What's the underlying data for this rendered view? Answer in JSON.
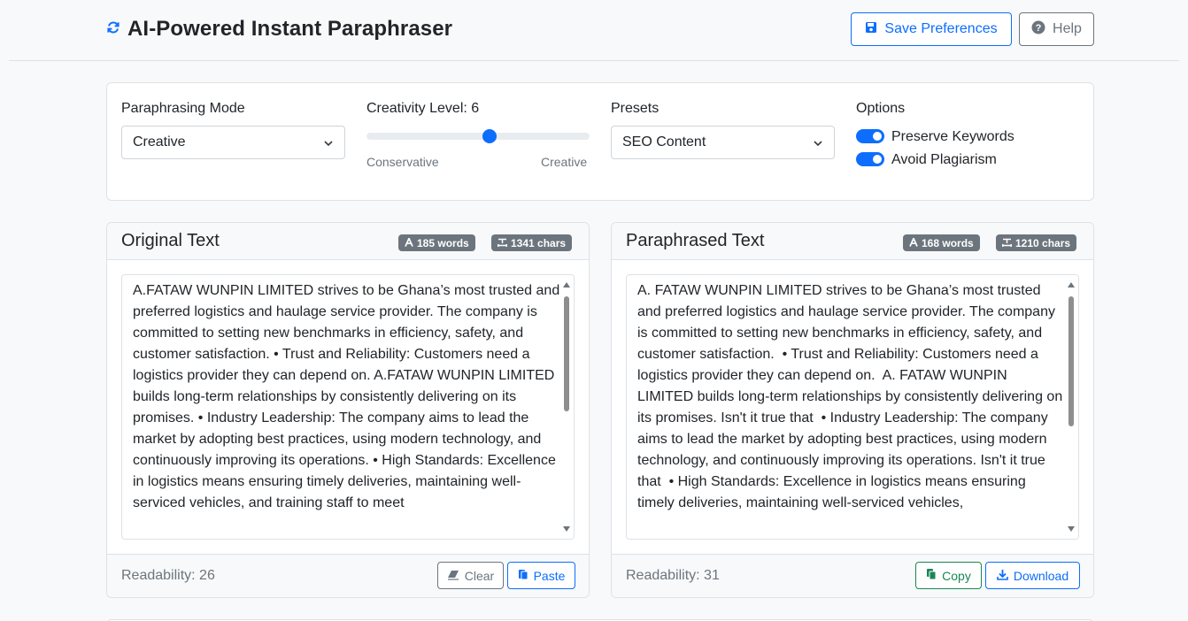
{
  "app": {
    "title": "AI-Powered Instant Paraphraser",
    "save_label": "Save Preferences",
    "help_label": "Help"
  },
  "settings": {
    "mode_label": "Paraphrasing Mode",
    "mode_value": "Creative",
    "creativity_label": "Creativity Level: 6",
    "creativity_value": 6,
    "creativity_min_label": "Conservative",
    "creativity_max_label": "Creative",
    "presets_label": "Presets",
    "presets_value": "SEO Content",
    "options_label": "Options",
    "option_1": "Preserve Keywords",
    "option_1_checked": true,
    "option_2": "Avoid Plagiarism",
    "option_2_checked": true
  },
  "original": {
    "title": "Original Text",
    "words": "185 words",
    "chars": "1341 chars",
    "text": "A.FATAW WUNPIN LIMITED strives to be Ghana’s most trusted and preferred logistics and haulage service provider. The company is committed to setting new benchmarks in efficiency, safety, and customer satisfaction. • Trust and Reliability: Customers need a logistics provider they can depend on. A.FATAW WUNPIN LIMITED builds long-term relationships by consistently delivering on its promises. • Industry Leadership: The company aims to lead the market by adopting best practices, using modern technology, and continuously improving its operations. • High Standards: Excellence in logistics means ensuring timely deliveries, maintaining well-serviced vehicles, and training staff to meet",
    "readability": "Readability: 26",
    "clear_label": "Clear",
    "paste_label": "Paste"
  },
  "paraphrased": {
    "title": "Paraphrased Text",
    "words": "168 words",
    "chars": "1210 chars",
    "text": "A. FATAW WUNPIN LIMITED strives to be Ghana’s most trusted and preferred logistics and haulage service provider. The company is committed to setting new benchmarks in efficiency, safety, and customer satisfaction.  • Trust and Reliability: Customers need a logistics provider they can depend on.  A. FATAW WUNPIN LIMITED builds long-term relationships by consistently delivering on its promises. Isn't it true that  • Industry Leadership: The company aims to lead the market by adopting best practices, using modern technology, and continuously improving its operations. Isn't it true that  • High Standards: Excellence in logistics means ensuring timely deliveries, maintaining well-serviced vehicles,",
    "readability": "Readability: 31",
    "copy_label": "Copy",
    "download_label": "Download"
  },
  "colors": {
    "primary": "#0d6efd",
    "secondary": "#6c757d",
    "success": "#198754"
  }
}
